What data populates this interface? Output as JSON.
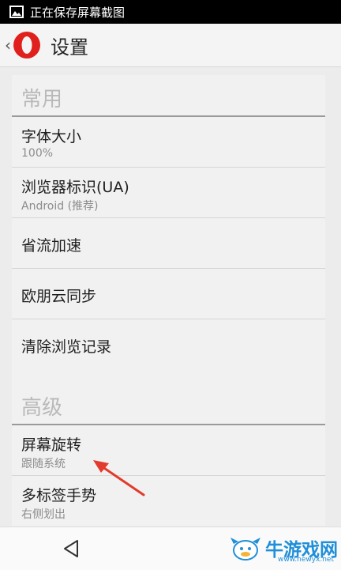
{
  "status_bar": {
    "text": "正在保存屏幕截图"
  },
  "app_bar": {
    "title": "设置"
  },
  "sections": [
    {
      "header": "常用",
      "items": [
        {
          "title": "字体大小",
          "subtitle": "100%"
        },
        {
          "title": "浏览器标识(UA)",
          "subtitle": "Android (推荐)"
        },
        {
          "title": "省流加速"
        },
        {
          "title": "欧朋云同步"
        },
        {
          "title": "清除浏览记录"
        }
      ]
    },
    {
      "header": "高级",
      "items": [
        {
          "title": "屏幕旋转",
          "subtitle": "跟随系统"
        },
        {
          "title": "多标签手势",
          "subtitle": "右侧划出"
        }
      ]
    }
  ],
  "watermark": {
    "name": "牛游戏网",
    "url": "www.newyx.net"
  },
  "colors": {
    "accent_red": "#e0201c",
    "arrow_red": "#e23b2e",
    "section_header": "#b9b9b9",
    "watermark_blue": "#1f8fd9"
  },
  "icons": {
    "status": "image-icon",
    "back": "back-chevron-icon",
    "logo": "opera-logo-icon",
    "nav_back": "nav-back-triangle-icon"
  }
}
